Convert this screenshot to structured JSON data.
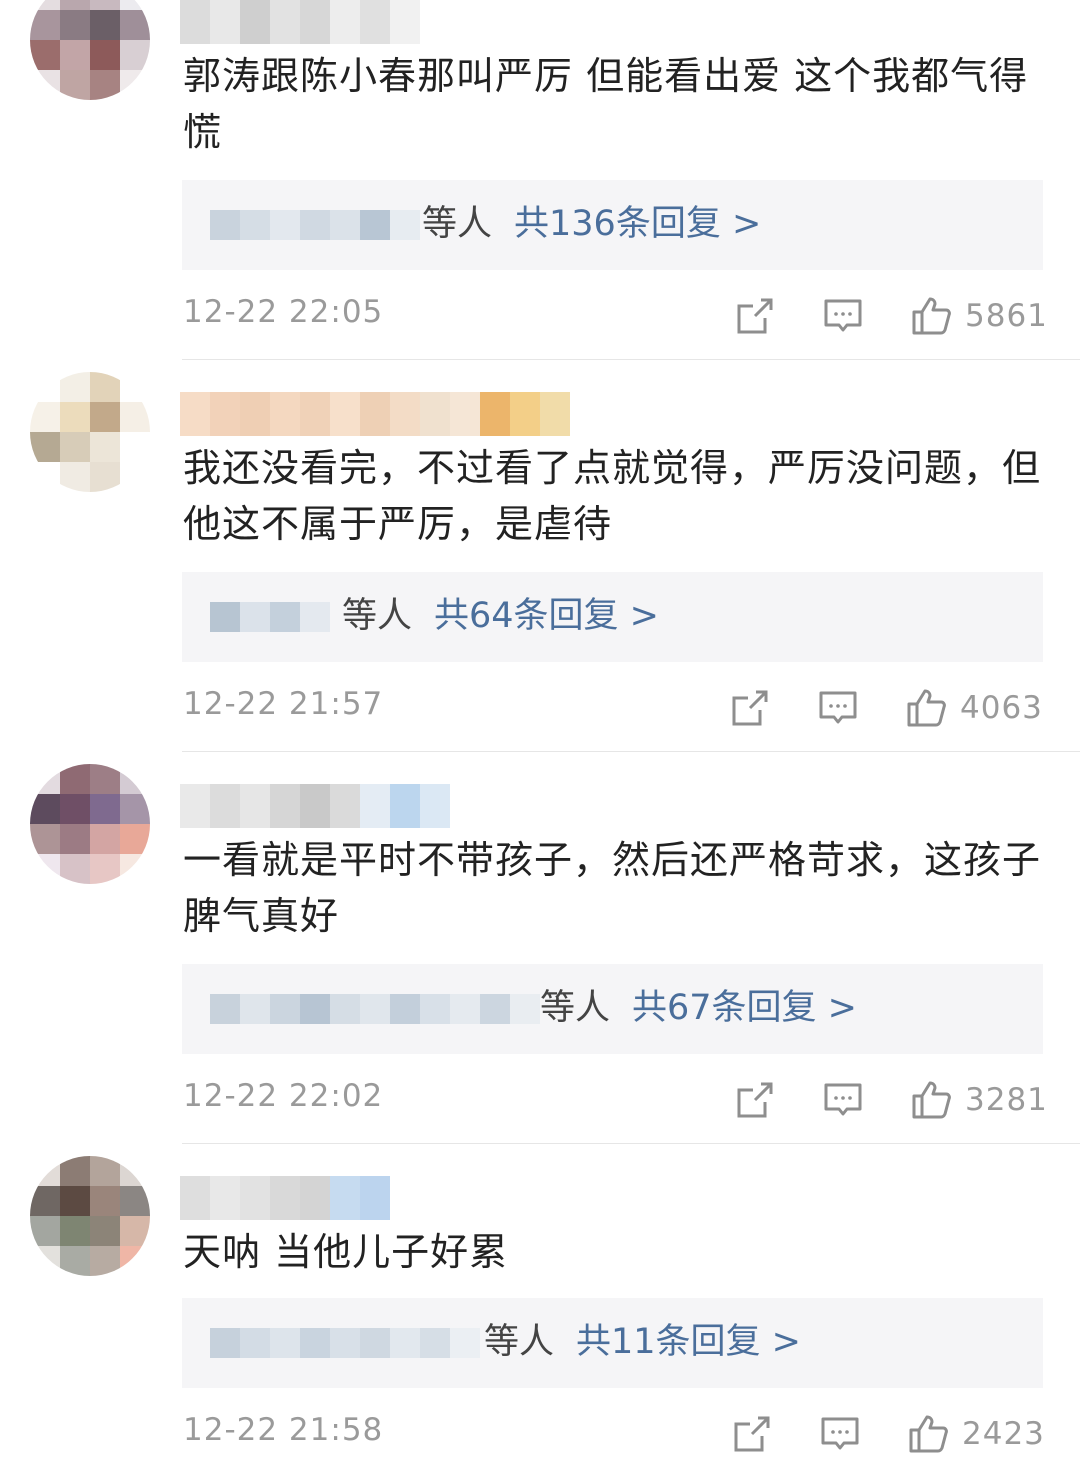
{
  "comments": [
    {
      "text": "郭涛跟陈小春那叫严厉 但能看出爱 这个我都气得慌",
      "reply_who": "等人",
      "reply_count": "共136条回复 >",
      "time": "12-22 22:05",
      "likes": "5861",
      "avatar_colors": [
        "#e4dde0",
        "#b9a7ad",
        "#c8b9bf",
        "#ecebef",
        "#a8959d",
        "#8a7b83",
        "#6b5f67",
        "#9f8f99",
        "#9b6d6c",
        "#c2a5a7",
        "#8d5a5a",
        "#d8cfd3",
        "#e9e2e4",
        "#bfa5a3",
        "#a78382",
        "#efeaeb"
      ],
      "name_colors": [
        "#dcdcdc",
        "#e8e8e8",
        "#cfcfcf",
        "#e2e2e2",
        "#d7d7d7",
        "#ededed",
        "#e0e0e0",
        "#f1f1f1"
      ],
      "blur_colors": [
        "#c9d3dd",
        "#d5dde5",
        "#e3e8ee",
        "#d0d9e2",
        "#dbe2e9",
        "#b8c6d4",
        "#e7ecf1"
      ]
    },
    {
      "text": "我还没看完，不过看了点就觉得，严厉没问题，但他这不属于严厉，是虐待",
      "reply_who": "等人",
      "reply_count": "共64条回复 >",
      "time": "12-22 21:57",
      "likes": "4063",
      "avatar_colors": [
        "#ffffff",
        "#f3efe6",
        "#e2d3b9",
        "#ffffff",
        "#f6f1e8",
        "#ecdcbc",
        "#c2a98a",
        "#f5efe6",
        "#b5a993",
        "#d7ccb8",
        "#ece5d8",
        "#ffffff",
        "#ffffff",
        "#f0ebe3",
        "#e7dfd2",
        "#ffffff"
      ],
      "name_colors": [
        "#f6dcc6",
        "#f2d2b9",
        "#efcfb4",
        "#f4d8c0",
        "#f0d2b8",
        "#f7e0cb",
        "#eed0b5",
        "#f3dcc6",
        "#f0e1cf",
        "#f5e6d6",
        "#ecb56b",
        "#f3cf88",
        "#f1dca9"
      ],
      "blur_colors": [
        "#b7c5d2",
        "#dbe2ea",
        "#c4d0dc",
        "#e4e9ef"
      ]
    },
    {
      "text": "一看就是平时不带孩子，然后还严格苛求，这孩子脾气真好",
      "reply_who": "等人",
      "reply_count": "共67条回复 >",
      "time": "12-22 22:02",
      "likes": "3281",
      "avatar_colors": [
        "#e3dbe0",
        "#8f6a73",
        "#9d7e86",
        "#d4cbd3",
        "#5d4b5e",
        "#6f4f66",
        "#7f6a8f",
        "#a595a8",
        "#ad9496",
        "#9c7b84",
        "#d3a5a3",
        "#e8a898",
        "#efe7ee",
        "#d7c2c7",
        "#e7c7c5",
        "#f6e8e1"
      ],
      "name_colors": [
        "#e9e9e9",
        "#dcdcdc",
        "#e6e6e6",
        "#d6d6d6",
        "#c9c9c9",
        "#dadada",
        "#e4ecf4",
        "#bcd6ee",
        "#dbe8f4"
      ],
      "blur_colors": [
        "#c8d2dc",
        "#dfe5eb",
        "#cbd5df",
        "#b7c5d3",
        "#d5dde5",
        "#e0e6ec",
        "#c3cfdb",
        "#d8e0e8",
        "#e5eaef",
        "#ccd6e0",
        "#e9edf1"
      ]
    },
    {
      "text": "天呐  当他儿子好累",
      "reply_who": "等人",
      "reply_count": "共11条回复 >",
      "time": "12-22 21:58",
      "likes": "2423",
      "avatar_colors": [
        "#e2dcd8",
        "#8c7c74",
        "#b3a49b",
        "#dcd6d2",
        "#6f6763",
        "#5c4a42",
        "#9a857b",
        "#8b8683",
        "#a3a6a0",
        "#7e8572",
        "#8c8478",
        "#d6b7a8",
        "#e3e1dd",
        "#a9aba4",
        "#b7aba2",
        "#efb6a6"
      ],
      "name_colors": [
        "#dedede",
        "#e8e8e8",
        "#e2e2e2",
        "#d9d9d9",
        "#d4d4d4",
        "#c6dbf0",
        "#bcd4ee"
      ],
      "blur_colors": [
        "#c6d1dc",
        "#d3dce5",
        "#dde4eb",
        "#c9d4df",
        "#d8e0e8",
        "#cfd8e1",
        "#e2e8ee",
        "#d6dee6",
        "#ebeff3"
      ]
    }
  ],
  "icons": {
    "repost": "repost-icon",
    "comment": "comment-icon",
    "like": "like-icon"
  }
}
